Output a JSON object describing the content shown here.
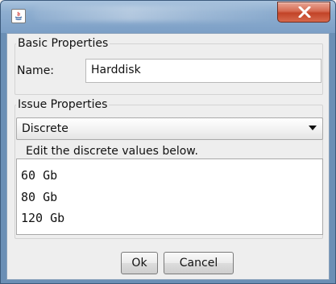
{
  "window": {
    "app_icon": "java-icon",
    "close_icon": "close-icon"
  },
  "basic_properties": {
    "title": "Basic Properties",
    "name_label": "Name:",
    "name_value": "Harddisk"
  },
  "issue_properties": {
    "title": "Issue Properties",
    "type_selected": "Discrete",
    "hint": "Edit the discrete values below.",
    "values": [
      "60 Gb",
      "80 Gb",
      "120 Gb"
    ]
  },
  "buttons": {
    "ok": "Ok",
    "cancel": "Cancel"
  }
}
